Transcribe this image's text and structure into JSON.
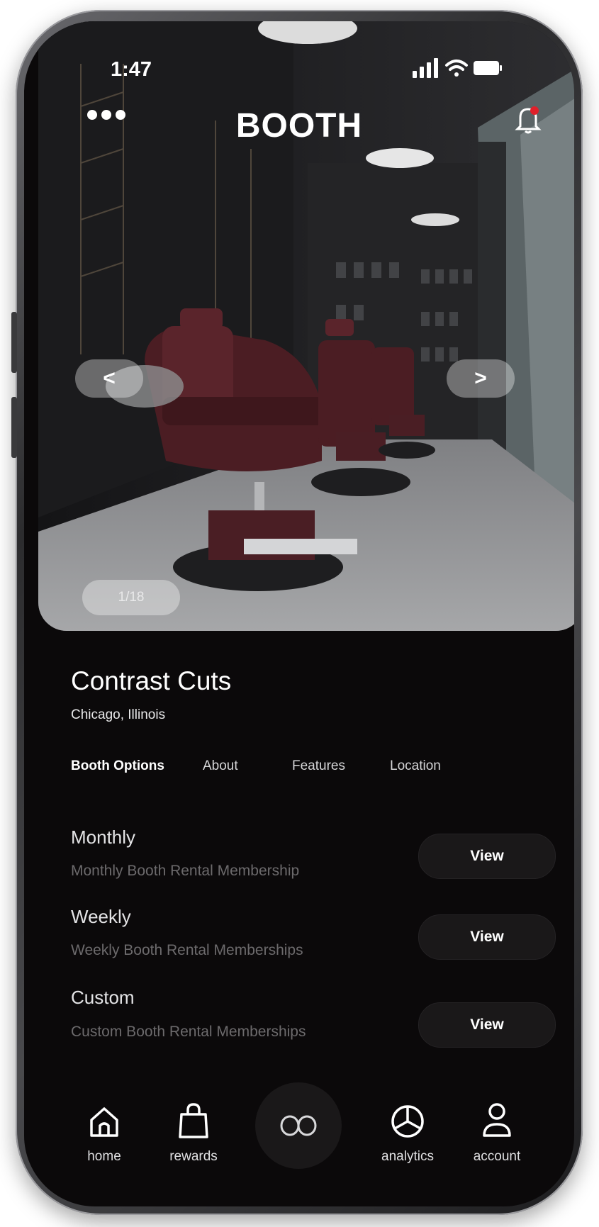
{
  "status": {
    "time": "1:47"
  },
  "header": {
    "brand": "BOOTH"
  },
  "gallery": {
    "prev": "<",
    "next": ">",
    "counter": "1/18"
  },
  "shop": {
    "name": "Contrast Cuts",
    "location": "Chicago, Illinois"
  },
  "tabs": [
    {
      "label": "Booth Options",
      "active": true
    },
    {
      "label": "About",
      "active": false
    },
    {
      "label": "Features",
      "active": false
    },
    {
      "label": "Location",
      "active": false
    }
  ],
  "options": [
    {
      "title": "Monthly",
      "description": "Monthly Booth Rental Membership",
      "button": "View"
    },
    {
      "title": "Weekly",
      "description": "Weekly Booth Rental Memberships",
      "button": "View"
    },
    {
      "title": "Custom",
      "description": "Custom Booth Rental Memberships",
      "button": "View"
    }
  ],
  "tabbar": {
    "home": "home",
    "rewards": "rewards",
    "center": "OO",
    "analytics": "analytics",
    "account": "account"
  },
  "colors": {
    "background": "#0b090a",
    "notification_dot": "#e0202a",
    "button": "#1a1819",
    "muted_text": "#6c6a6c"
  }
}
